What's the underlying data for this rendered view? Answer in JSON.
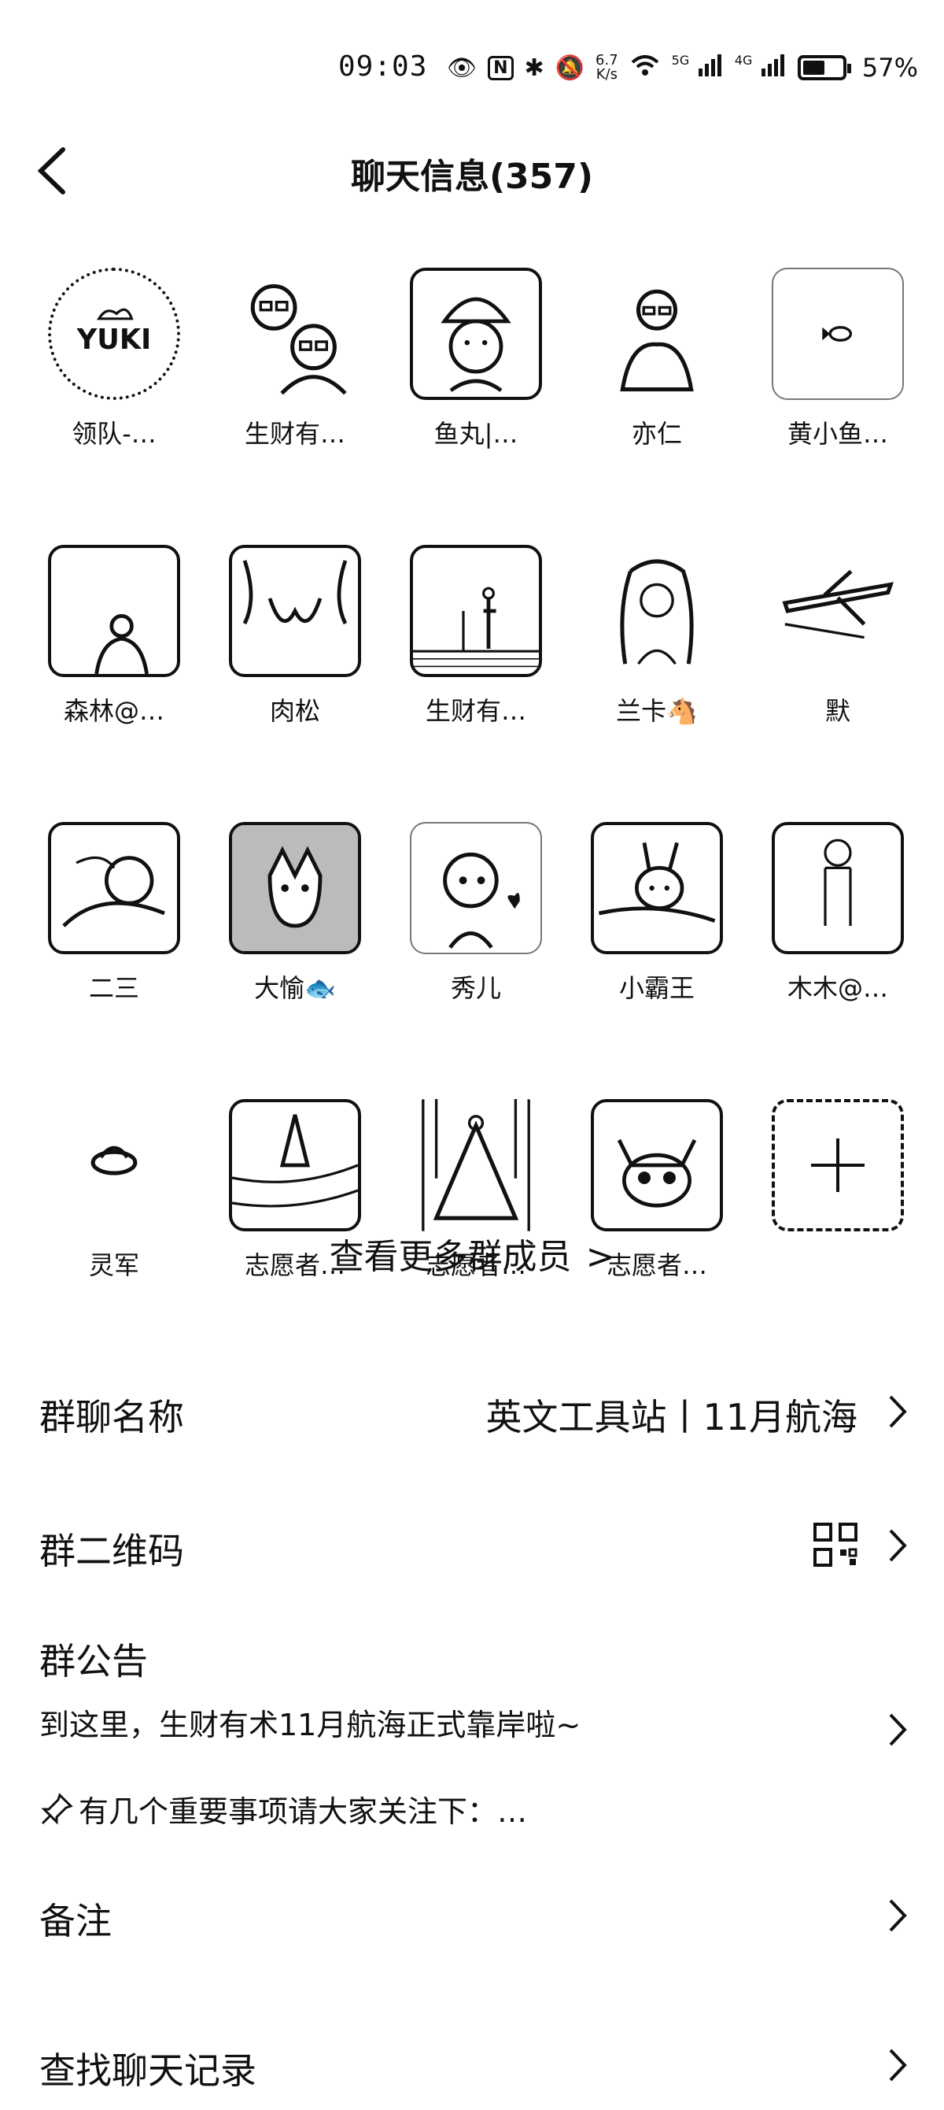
{
  "status_bar": {
    "time": "09:03",
    "net_speed_value": "6.7",
    "net_speed_unit": "K/s",
    "sig1": "5G",
    "sig2": "4G",
    "battery_percent": "57%",
    "battery_level": 0.57
  },
  "header": {
    "title": "聊天信息(357)"
  },
  "members": [
    {
      "name": "领队-…",
      "avatar": "yuki-logo"
    },
    {
      "name": "生财有…",
      "avatar": "cartoon-couple"
    },
    {
      "name": "鱼丸|…",
      "avatar": "cartoon-mushroom"
    },
    {
      "name": "亦仁",
      "avatar": "person-glasses"
    },
    {
      "name": "黄小鱼…",
      "avatar": "small-fish"
    },
    {
      "name": "森林@…",
      "avatar": "person-back"
    },
    {
      "name": "肉松",
      "avatar": "abstract-sketch"
    },
    {
      "name": "生财有…",
      "avatar": "beach-scene"
    },
    {
      "name": "兰卡🐴",
      "avatar": "curly-hair-girl"
    },
    {
      "name": "默",
      "avatar": "airplane-sketch"
    },
    {
      "name": "二三",
      "avatar": "sleeping-person"
    },
    {
      "name": "大愉🐟",
      "avatar": "cat-photo"
    },
    {
      "name": "秀儿",
      "avatar": "cartoon-girl-heart"
    },
    {
      "name": "小霸王",
      "avatar": "rabbit-in-bed"
    },
    {
      "name": "木木@…",
      "avatar": "standing-figure"
    },
    {
      "name": "灵军",
      "avatar": "ufo"
    },
    {
      "name": "志愿者…",
      "avatar": "sail-sketch"
    },
    {
      "name": "志愿者…",
      "avatar": "dress-figure"
    },
    {
      "name": "志愿者…",
      "avatar": "fluffy-cat"
    }
  ],
  "more_members_label": "查看更多群成员",
  "group_name": {
    "label": "群聊名称",
    "value": "英文工具站丨11月航海"
  },
  "qr_code": {
    "label": "群二维码"
  },
  "notice": {
    "label": "群公告",
    "line1": "到这里，生财有术11月航海正式靠岸啦~",
    "line2": "有几个重要事项请大家关注下：…"
  },
  "remark": {
    "label": "备注"
  },
  "search_history": {
    "label": "查找聊天记录"
  }
}
